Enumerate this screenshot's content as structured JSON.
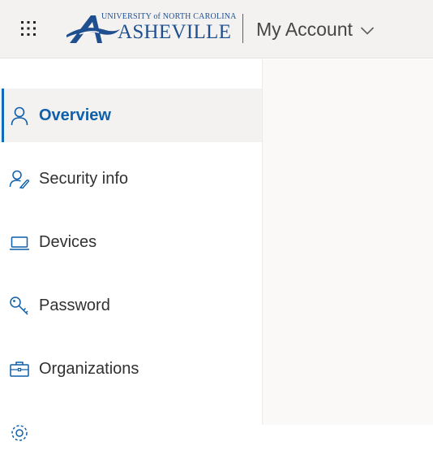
{
  "header": {
    "logo": {
      "line1": "UNIVERSITY of NORTH CAROLINA",
      "line2": "ASHEVILLE"
    },
    "app_title": "My Account"
  },
  "icons": {
    "apps": "waffle-grid-icon",
    "expand": "chevron-down-icon"
  },
  "nav": {
    "items": [
      {
        "label": "Overview",
        "icon": "person-icon",
        "selected": true
      },
      {
        "label": "Security info",
        "icon": "person-key-icon",
        "selected": false
      },
      {
        "label": "Devices",
        "icon": "laptop-icon",
        "selected": false
      },
      {
        "label": "Password",
        "icon": "key-icon",
        "selected": false
      },
      {
        "label": "Organizations",
        "icon": "briefcase-icon",
        "selected": false
      }
    ]
  },
  "colors": {
    "accent": "#0f6cbd",
    "brand_blue": "#1f4f8f",
    "header_bg": "#f3f2f1",
    "selected_bg": "#f3f2f1"
  }
}
